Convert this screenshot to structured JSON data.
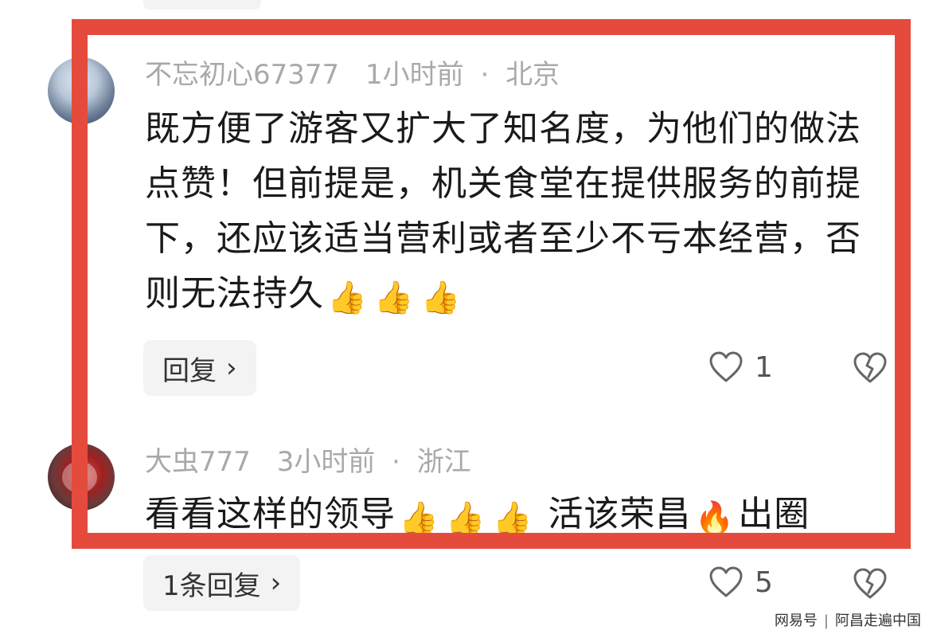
{
  "comments": [
    {
      "username": "不忘初心67377",
      "time": "1小时前",
      "location": "北京",
      "text": "既方便了游客又扩大了知名度，为他们的做法点赞！但前提是，机关食堂在提供服务的前提下，还应该适当营利或者至少不亏本经营，否则无法持久",
      "emojis": [
        "👍",
        "👍",
        "👍"
      ],
      "reply_label": "回复",
      "likes": "1"
    },
    {
      "username": "大虫777",
      "time": "3小时前",
      "location": "浙江",
      "text_part1": "看看这样的领导",
      "text_part2": "活该荣昌",
      "text_part3": "出圈",
      "emojis": [
        "👍",
        "👍",
        "👍"
      ],
      "fire_emoji": "🔥",
      "reply_label": "1条回复",
      "likes": "5"
    }
  ],
  "separator": "·",
  "chevron": "›",
  "watermark": {
    "left": "网易号",
    "right": "阿昌走遍中国"
  },
  "colors": {
    "highlight": "#e54b3c",
    "meta_text": "#a9a9a9",
    "button_bg": "#f3f3f3"
  }
}
